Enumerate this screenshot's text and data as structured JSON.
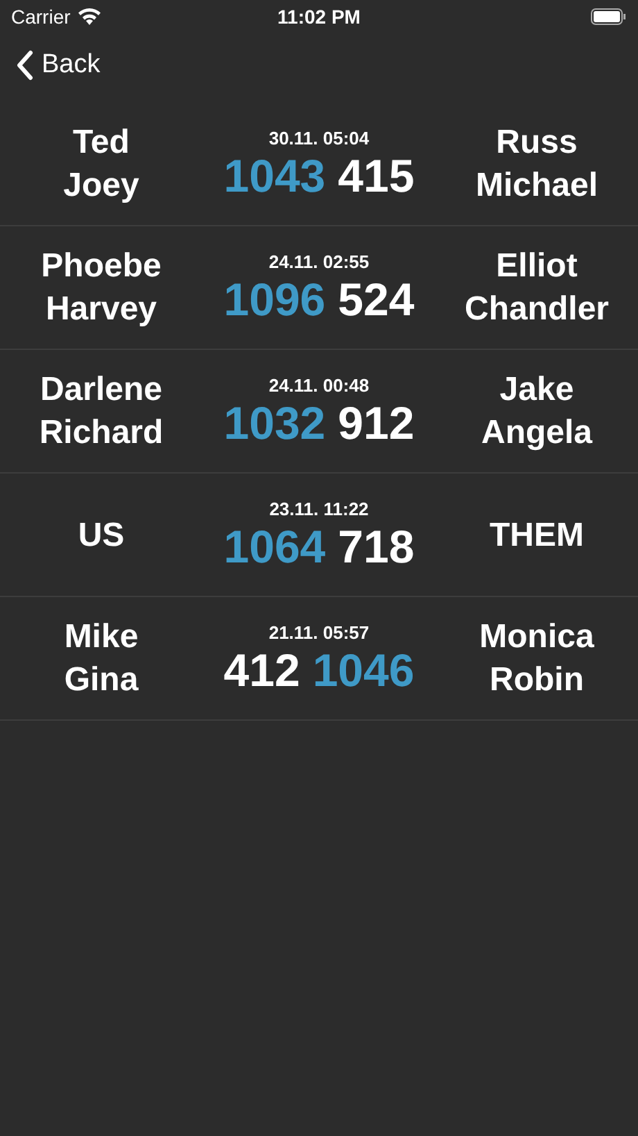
{
  "status_bar": {
    "carrier": "Carrier",
    "time": "11:02 PM"
  },
  "nav": {
    "back": "Back"
  },
  "games": [
    {
      "left_team": [
        "Ted",
        "Joey"
      ],
      "date": "30.11. 05:04",
      "left_score": {
        "value": "1043",
        "winner": true
      },
      "right_score": {
        "value": "415",
        "winner": false
      },
      "right_team": [
        "Russ",
        "Michael"
      ]
    },
    {
      "left_team": [
        "Phoebe",
        "Harvey"
      ],
      "date": "24.11. 02:55",
      "left_score": {
        "value": "1096",
        "winner": true
      },
      "right_score": {
        "value": "524",
        "winner": false
      },
      "right_team": [
        "Elliot",
        "Chandler"
      ]
    },
    {
      "left_team": [
        "Darlene",
        "Richard"
      ],
      "date": "24.11. 00:48",
      "left_score": {
        "value": "1032",
        "winner": true
      },
      "right_score": {
        "value": "912",
        "winner": false
      },
      "right_team": [
        "Jake",
        "Angela"
      ]
    },
    {
      "left_team": [
        "US"
      ],
      "date": "23.11. 11:22",
      "left_score": {
        "value": "1064",
        "winner": true
      },
      "right_score": {
        "value": "718",
        "winner": false
      },
      "right_team": [
        "THEM"
      ]
    },
    {
      "left_team": [
        "Mike",
        "Gina"
      ],
      "date": "21.11. 05:57",
      "left_score": {
        "value": "412",
        "winner": false
      },
      "right_score": {
        "value": "1046",
        "winner": true
      },
      "right_team": [
        "Monica",
        "Robin"
      ]
    }
  ]
}
